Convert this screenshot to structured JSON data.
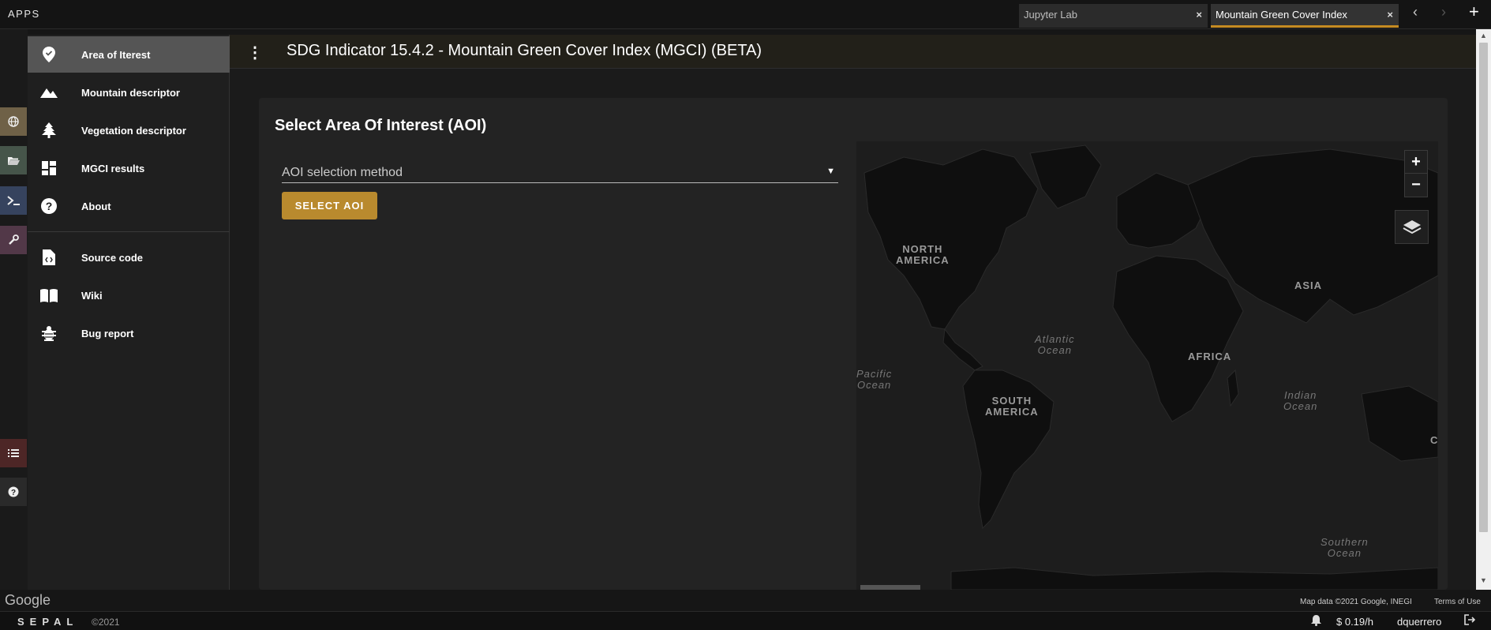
{
  "topbar": {
    "apps_label": "APPS",
    "tabs": [
      {
        "label": "Jupyter Lab",
        "close": "×"
      },
      {
        "label": "Mountain Green Cover Index",
        "close": "×"
      }
    ],
    "back": "‹",
    "forward": "›",
    "add": "+"
  },
  "drawer": {
    "items": [
      {
        "label": "Area of Iterest",
        "icon": "map-marker-icon"
      },
      {
        "label": "Mountain descriptor",
        "icon": "mountain-icon"
      },
      {
        "label": "Vegetation descriptor",
        "icon": "tree-icon"
      },
      {
        "label": "MGCI results",
        "icon": "dashboard-icon"
      },
      {
        "label": "About",
        "icon": "question-icon"
      },
      {
        "label": "Source code",
        "icon": "code-file-icon"
      },
      {
        "label": "Wiki",
        "icon": "book-icon"
      },
      {
        "label": "Bug report",
        "icon": "bug-icon"
      }
    ]
  },
  "header": {
    "menu": "⋮",
    "title": "SDG Indicator 15.4.2 - Mountain Green Cover Index (MGCI) (BETA)"
  },
  "main": {
    "card_title": "Select Area Of Interest (AOI)",
    "aoi_select_placeholder": "AOI selection method",
    "select_aoi_button": "SELECT AOI"
  },
  "map": {
    "zoom_in": "+",
    "zoom_out": "−",
    "labels": {
      "north_america": "NORTH\nAMERICA",
      "south_america": "SOUTH\nAMERICA",
      "africa": "AFRICA",
      "asia": "ASIA",
      "atlantic": "Atlantic\nOcean",
      "pacific": "Pacific\nOcean",
      "indian": "Indian\nOcean",
      "southern": "Southern\nOcean",
      "edge": "C"
    }
  },
  "map_footer": {
    "google": "Google",
    "attribution": "Map data ©2021 Google, INEGI",
    "terms": "Terms of Use"
  },
  "statusbar": {
    "logo": "SEPAL",
    "copyright": "©2021",
    "cost": "$ 0.19/h",
    "user": "dquerrero"
  },
  "colors": {
    "accent": "#c58b22",
    "button": "#b98a2e",
    "rail_globe": "#7a6a4a",
    "rail_folder": "#4a5a4a",
    "rail_terminal": "#3a4a6a",
    "rail_wrench": "#5a3a4a",
    "rail_tasks": "#5a2a2a"
  }
}
